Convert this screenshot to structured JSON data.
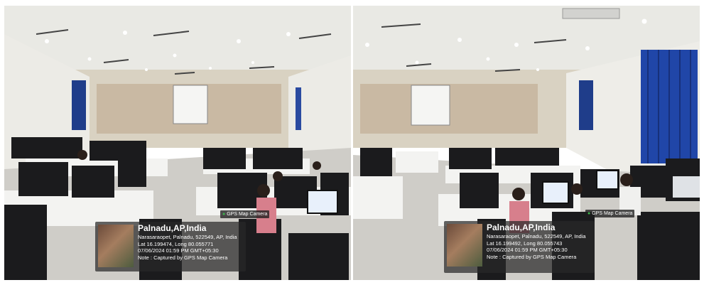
{
  "photos": [
    {
      "badge": "GPS Map Camera",
      "location": "Palnadu,AP,India",
      "address": "Narasaraopet, Palnadu, 522549, AP, India",
      "coords": "Lat 16.199474, Long 80.055771",
      "datetime": "07/06/2024 01:59 PM GMT+05:30",
      "note": "Note : Captured by GPS Map Camera"
    },
    {
      "badge": "GPS Map Camera",
      "location": "Palnadu,AP,India",
      "address": "Narasaraopet, Palnadu, 522549, AP, India",
      "coords": "Lat 16.199492, Long 80.055743",
      "datetime": "07/06/2024 01:59 PM GMT+05:30",
      "note": "Note : Captured by GPS Map Camera"
    }
  ]
}
